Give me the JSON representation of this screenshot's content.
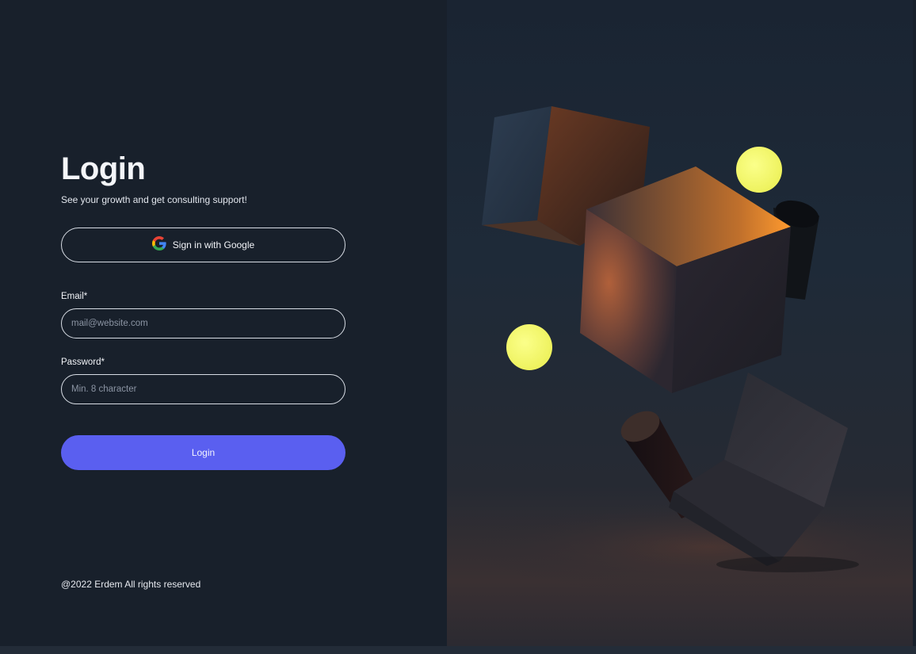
{
  "login": {
    "title": "Login",
    "subtitle": "See your growth and get consulting support!",
    "google_button_label": "Sign in with Google",
    "email_label": "Email*",
    "email_placeholder": "mail@website.com",
    "email_value": "",
    "password_label": "Password*",
    "password_placeholder": "Min. 8 character",
    "password_value": "",
    "submit_label": "Login",
    "footer": "@2022 Erdem All rights reserved"
  },
  "hero_image": {
    "icon": "abstract-3d-cubes-illustration"
  },
  "colors": {
    "background": "#18202b",
    "accent": "#5a5ff0",
    "sphere": "#f4f76a",
    "cube_glow": "#ff9a2e"
  }
}
